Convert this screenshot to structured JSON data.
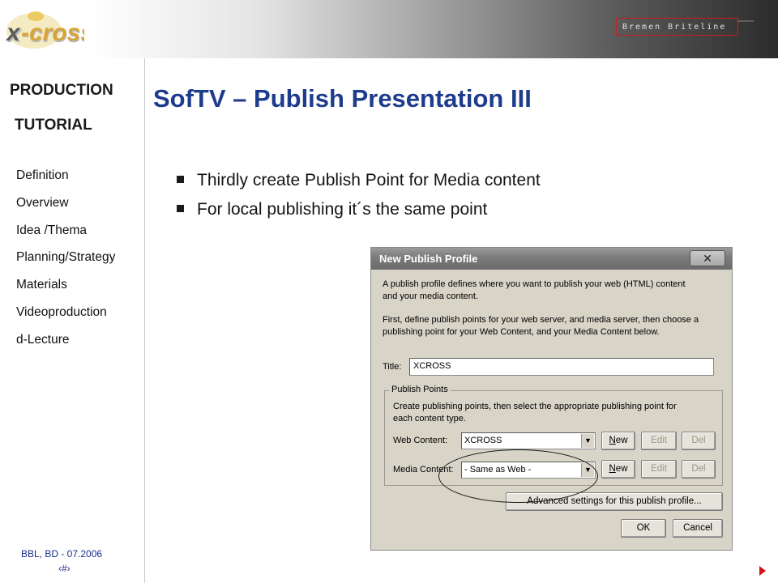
{
  "header": {
    "logo_text": "x-cross",
    "brand_text": "Bremen Briteline",
    "accent_color": "#c81e1e"
  },
  "sidebar": {
    "heading_line1": "PRODUCTION",
    "heading_line2": "TUTORIAL",
    "items": [
      {
        "label": "Definition"
      },
      {
        "label": "Overview"
      },
      {
        "label": "Idea /Thema"
      },
      {
        "label": "Planning/Strategy"
      },
      {
        "label": "Materials"
      },
      {
        "label": "Videoproduction"
      },
      {
        "label": "d-Lecture"
      }
    ],
    "footer_credit": "BBL, BD - 07.2006",
    "footer_page": "‹#›"
  },
  "slide": {
    "title": "SofTV – Publish Presentation III",
    "title_color": "#1e3c8c",
    "bullets": [
      "Thirdly create Publish Point for Media content",
      "For local publishing it´s the same point"
    ]
  },
  "dialog": {
    "title": "New Publish Profile",
    "close_symbol": "✕",
    "intro_line1": "A publish profile defines where you want to publish your web (HTML) content",
    "intro_line2": "and your media content.",
    "instr_line1": "First, define publish points for your web server, and media server, then choose a",
    "instr_line2": "publishing point for your Web Content, and your Media Content below.",
    "title_label": "Title:",
    "title_value": "XCROSS",
    "group_label": "Publish Points",
    "group_text_line1": "Create publishing points, then select the appropriate publishing point for",
    "group_text_line2": "each content type.",
    "web_content_label": "Web Content:",
    "web_content_value": "XCROSS",
    "media_content_label": "Media Content:",
    "media_content_value": "- Same as Web -",
    "new_label": "New",
    "edit_label": "Edit",
    "del_label": "Del",
    "advanced_label": "Advanced settings for this publish profile...",
    "ok_label": "OK",
    "cancel_label": "Cancel"
  },
  "nav": {
    "next_icon": "next-slide-icon"
  }
}
